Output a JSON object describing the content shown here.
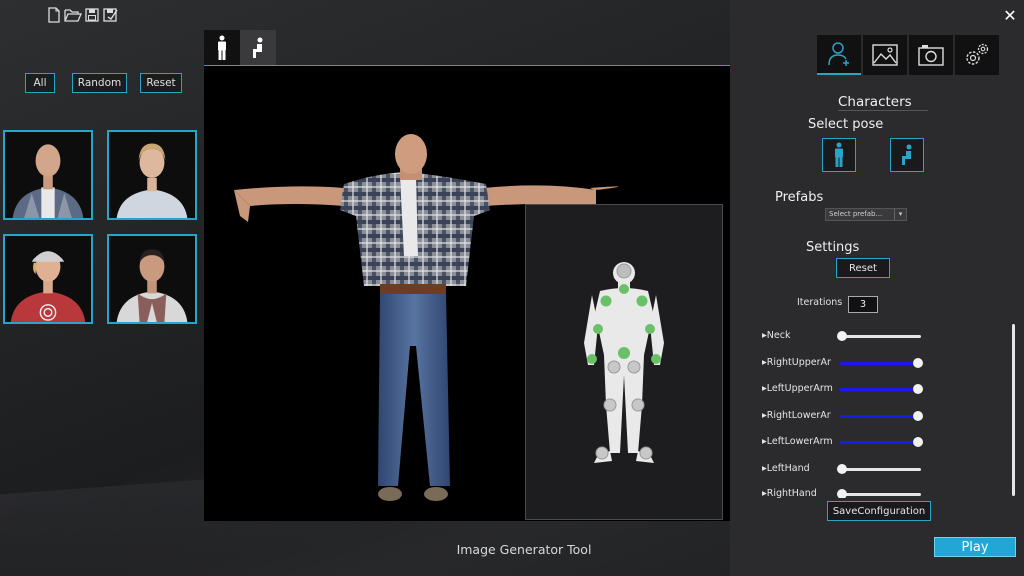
{
  "top_toolbar": {
    "icons": [
      "new-file-icon",
      "open-folder-icon",
      "save-icon",
      "save-as-icon"
    ]
  },
  "left_panel": {
    "buttons": {
      "all": "All",
      "random": "Random",
      "reset": "Reset"
    },
    "characters": [
      "bald-man-thumbnail",
      "blonde-woman-thumbnail",
      "cap-man-thumbnail",
      "scarf-man-thumbnail"
    ]
  },
  "pose_tabs": [
    "standing-pose-icon",
    "sitting-pose-icon"
  ],
  "footer": {
    "title": "Image Generator Tool"
  },
  "right_panel": {
    "tabs": [
      "add-character-icon",
      "image-icon",
      "camera-icon",
      "settings-gears-icon"
    ],
    "characters_heading": "Characters",
    "select_pose_heading": "Select pose",
    "prefabs_heading": "Prefabs",
    "prefab_select_value": "Select prefab...",
    "settings_heading": "Settings",
    "reset_label": "Reset",
    "iterations_label": "Iterations",
    "iterations_value": "3",
    "sliders": [
      {
        "label": "▸Neck",
        "value": 0.0,
        "active": false
      },
      {
        "label": "▸RightUpperAr",
        "value": 1.0,
        "active": true
      },
      {
        "label": "▸LeftUpperArm",
        "value": 1.0,
        "active": true
      },
      {
        "label": "▸RightLowerAr",
        "value": 1.0,
        "active": true
      },
      {
        "label": "▸LeftLowerArm",
        "value": 1.0,
        "active": true
      },
      {
        "label": "▸LeftHand",
        "value": 0.0,
        "active": false
      },
      {
        "label": "▸RightHand",
        "value": 0.0,
        "active": false
      }
    ],
    "save_label": "SaveConfiguration",
    "play_label": "Play"
  },
  "colors": {
    "accent": "#2aa3c9",
    "slider_active": "#1a1aee",
    "slider_inactive": "#e6e6e6",
    "play": "#22a6d6",
    "joint_green": "#6abf69"
  }
}
